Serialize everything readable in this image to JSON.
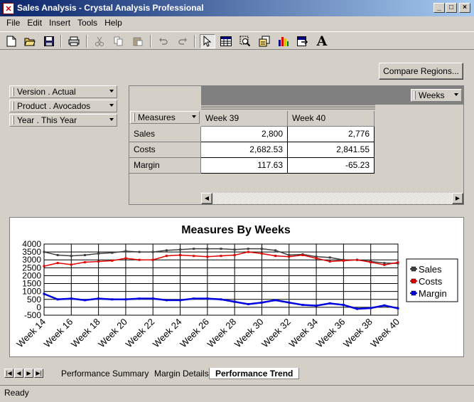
{
  "window": {
    "title": "Sales Analysis - Crystal Analysis Professional"
  },
  "menu": [
    {
      "label": "File"
    },
    {
      "label": "Edit"
    },
    {
      "label": "Insert"
    },
    {
      "label": "Tools"
    },
    {
      "label": "Help"
    }
  ],
  "toolbar": {
    "icons": [
      "new-icon",
      "open-icon",
      "save-icon",
      "print-icon",
      "cut-icon",
      "copy-icon",
      "paste-icon",
      "undo-icon",
      "redo-icon",
      "pointer-icon",
      "grid-icon",
      "zoom-icon",
      "analysis-icon",
      "chart-icon",
      "export-icon",
      "text-icon"
    ],
    "text_tool": "A"
  },
  "compare_button": "Compare Regions...",
  "slicers": [
    {
      "label": "Version . Actual"
    },
    {
      "label": "Product . Avocados"
    },
    {
      "label": "Year . This Year"
    }
  ],
  "grid": {
    "column_dimension": "Weeks",
    "row_dimension": "Measures",
    "columns": [
      "Week 39",
      "Week 40"
    ],
    "rows": [
      {
        "label": "Sales",
        "values": [
          "2,800",
          "2,776"
        ]
      },
      {
        "label": "Costs",
        "values": [
          "2,682.53",
          "2,841.55"
        ]
      },
      {
        "label": "Margin",
        "values": [
          "117.63",
          "-65.23"
        ]
      }
    ]
  },
  "chart_data": {
    "type": "line",
    "title": "Measures By Weeks",
    "ylim": [
      -500,
      4000
    ],
    "yticks": [
      "4000",
      "3500",
      "3000",
      "2500",
      "2000",
      "1500",
      "1000",
      "500",
      "0",
      "-500"
    ],
    "xticks": [
      "Week 14",
      "Week 16",
      "Week 18",
      "Week 20",
      "Week 22",
      "Week 24",
      "Week 26",
      "Week 28",
      "Week 30",
      "Week 32",
      "Week 34",
      "Week 36",
      "Week 38",
      "Week 40"
    ],
    "x": [
      14,
      15,
      16,
      17,
      18,
      19,
      20,
      21,
      22,
      23,
      24,
      25,
      26,
      27,
      28,
      29,
      30,
      31,
      32,
      33,
      34,
      35,
      36,
      37,
      38,
      39,
      40
    ],
    "grid": true,
    "legend": "right",
    "series": [
      {
        "name": "Sales",
        "color": "#404040",
        "values": [
          3500,
          3300,
          3250,
          3300,
          3400,
          3450,
          3550,
          3500,
          3500,
          3600,
          3650,
          3700,
          3700,
          3700,
          3650,
          3700,
          3700,
          3600,
          3300,
          3350,
          3200,
          3150,
          3000,
          3000,
          2900,
          2800,
          2776
        ]
      },
      {
        "name": "Costs",
        "color": "#e00000",
        "values": [
          2600,
          2800,
          2700,
          2850,
          2900,
          2950,
          3100,
          3000,
          3000,
          3250,
          3300,
          3250,
          3200,
          3250,
          3300,
          3500,
          3400,
          3250,
          3200,
          3300,
          3100,
          2900,
          2950,
          3000,
          2850,
          2683,
          2842
        ]
      },
      {
        "name": "Margin",
        "color": "#0000e0",
        "values": [
          850,
          500,
          550,
          450,
          550,
          500,
          500,
          550,
          550,
          450,
          450,
          550,
          550,
          500,
          350,
          200,
          300,
          450,
          300,
          150,
          100,
          250,
          150,
          -100,
          -50,
          118,
          -65
        ]
      }
    ]
  },
  "tabs": [
    {
      "label": "Performance Summary"
    },
    {
      "label": "Margin Details"
    },
    {
      "label": "Performance Trend"
    }
  ],
  "status": "Ready"
}
